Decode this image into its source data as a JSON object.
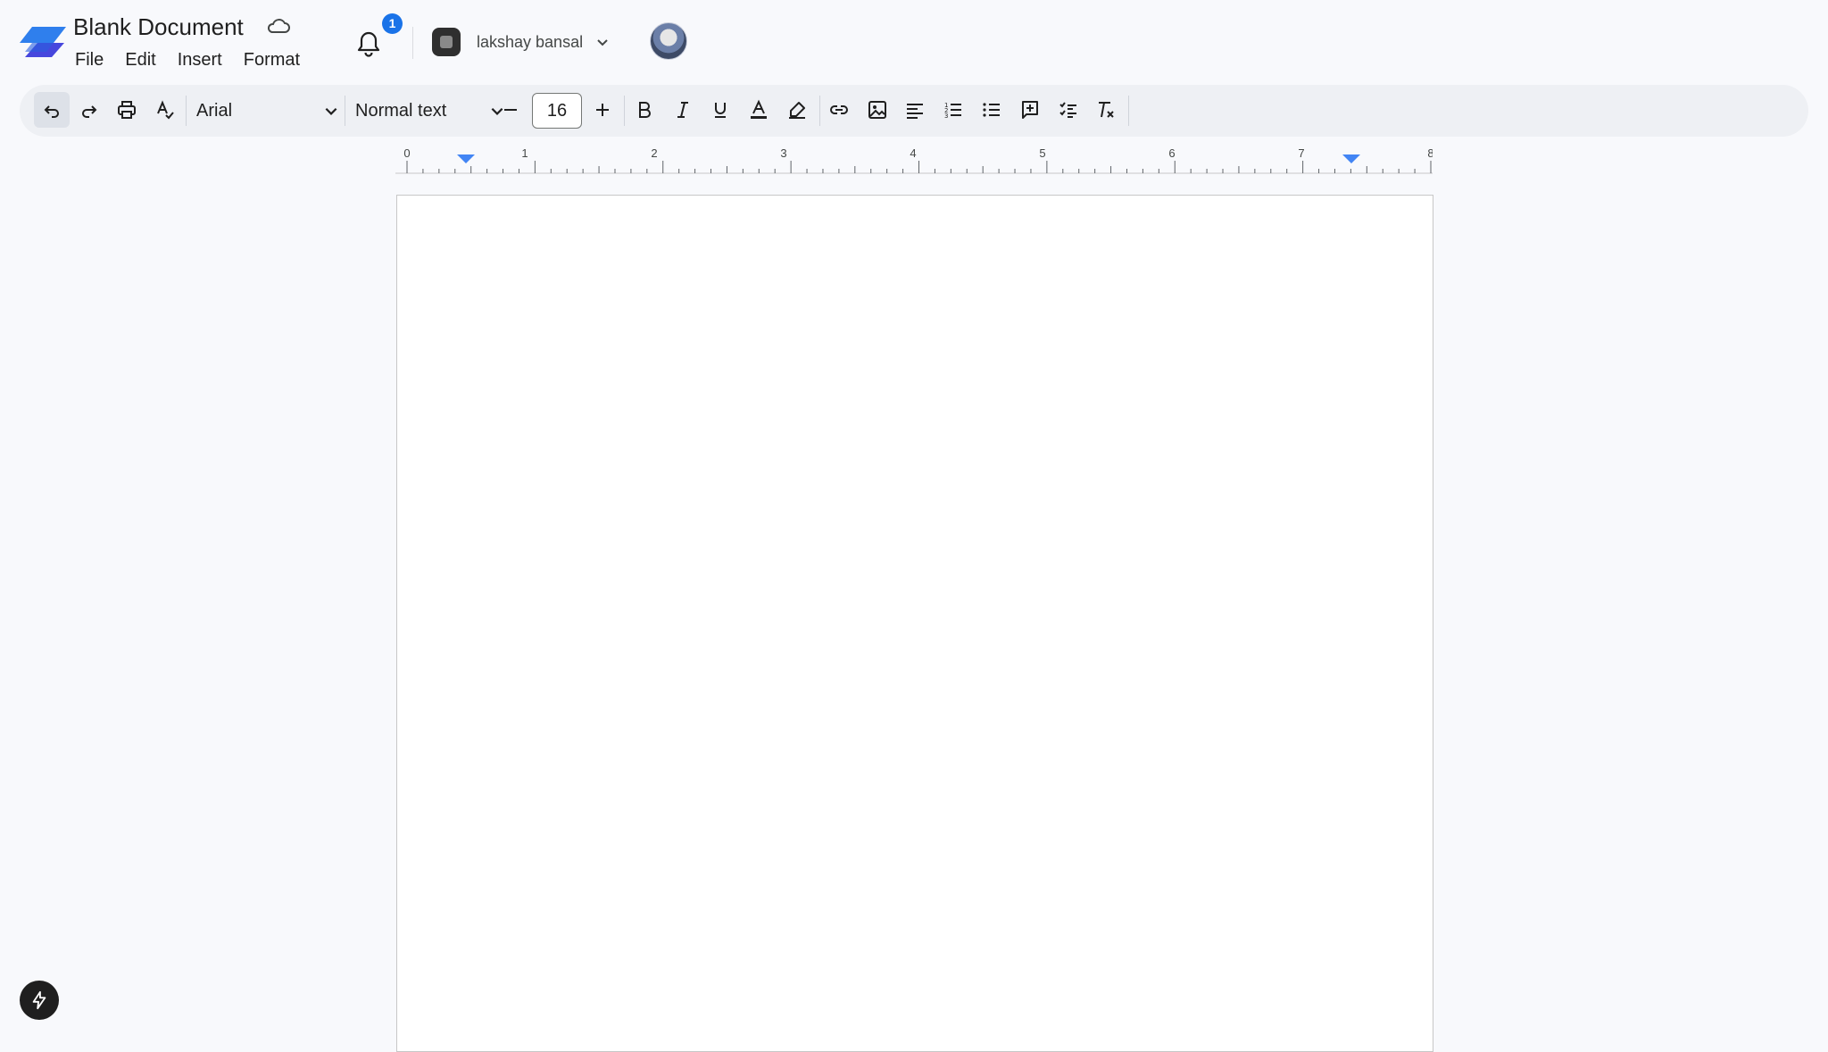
{
  "header": {
    "title": "Blank Document",
    "menu": [
      "File",
      "Edit",
      "Insert",
      "Format"
    ],
    "notification_count": "1",
    "account_name": "lakshay bansal"
  },
  "toolbar": {
    "font": "Arial",
    "text_style": "Normal text",
    "font_size": "16"
  },
  "ruler": {
    "marks": [
      "0",
      "1",
      "2",
      "3",
      "4",
      "5",
      "6",
      "7",
      "8"
    ]
  },
  "colors": {
    "accent": "#1a73e8",
    "ruler_indent": "#4285f4",
    "logo_light": "#2f7fed",
    "logo_dark": "#3d3ddb"
  }
}
